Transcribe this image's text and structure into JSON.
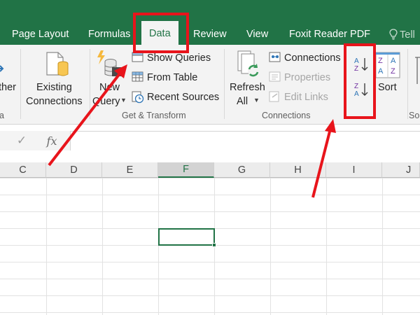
{
  "tabs": {
    "page_layout": "Page Layout",
    "formulas": "Formulas",
    "data": "Data",
    "review": "Review",
    "view": "View",
    "foxit": "Foxit Reader PDF",
    "tell_me": "Tell"
  },
  "ribbon": {
    "get_external": {
      "label": "ther",
      "group": "a"
    },
    "existing_connections": {
      "line1": "Existing",
      "line2": "Connections"
    },
    "new_query": {
      "line1": "New",
      "line2": "Query"
    },
    "show_queries": "Show Queries",
    "from_table": "From Table",
    "recent_sources": "Recent Sources",
    "get_transform_group": "Get & Transform",
    "refresh_all": {
      "line1": "Refresh",
      "line2": "All"
    },
    "connections": "Connections",
    "properties": "Properties",
    "edit_links": "Edit Links",
    "connections_group": "Connections",
    "sort_az_letters": {
      "top": "A",
      "bottom": "Z"
    },
    "sort_za_letters": {
      "top": "Z",
      "bottom": "A"
    },
    "sort_dialog_letters": {
      "tl": "Z",
      "tr": "A",
      "bl": "A",
      "br": "Z"
    },
    "sort": "Sort",
    "next_group_partial": "So"
  },
  "formula_bar": {
    "enter_symbol": "✓",
    "fx": "fx",
    "value": ""
  },
  "columns": [
    "C",
    "D",
    "E",
    "F",
    "G",
    "H",
    "I",
    "J"
  ],
  "selected_column": "F",
  "colors": {
    "excel_green": "#217346",
    "annotation_red": "#e8141b"
  }
}
